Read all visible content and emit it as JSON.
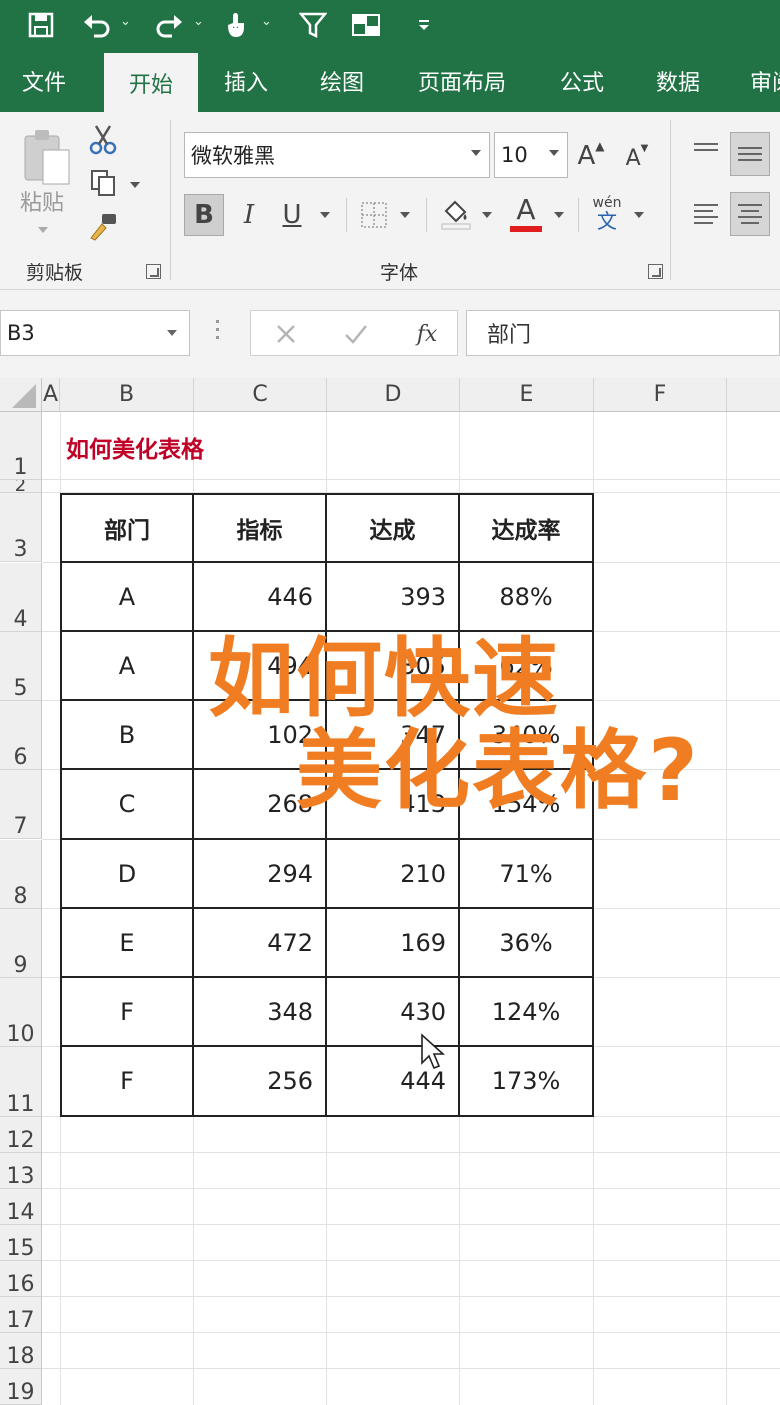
{
  "qat": {
    "icons": [
      "save-icon",
      "undo-icon",
      "redo-icon",
      "touch-mode-icon",
      "filter-icon",
      "freeze-panes-icon",
      "customize-qat-icon"
    ]
  },
  "tabs": [
    {
      "label": "文件"
    },
    {
      "label": "开始",
      "active": true
    },
    {
      "label": "插入"
    },
    {
      "label": "绘图"
    },
    {
      "label": "页面布局"
    },
    {
      "label": "公式"
    },
    {
      "label": "数据"
    },
    {
      "label": "审阅"
    }
  ],
  "ribbon": {
    "clipboard": {
      "paste_label": "粘贴",
      "group_label": "剪贴板"
    },
    "font": {
      "font_name": "微软雅黑",
      "font_size": "10",
      "bold": "B",
      "italic": "I",
      "underline": "U",
      "font_color_glyph": "A",
      "phonetic_top": "wén",
      "phonetic_bottom": "文",
      "grow_glyph": "A",
      "shrink_glyph": "A",
      "group_label": "字体"
    },
    "colors": {
      "font_color": "#e01e1e",
      "accent": "#217346"
    }
  },
  "formula_bar": {
    "name_box": "B3",
    "fx_label": "fx",
    "content": "部门"
  },
  "sheet": {
    "columns": [
      "A",
      "B",
      "C",
      "D",
      "E",
      "F"
    ],
    "rows": [
      "1",
      "2",
      "3",
      "4",
      "5",
      "6",
      "7",
      "8",
      "9",
      "10",
      "11",
      "12",
      "13",
      "14",
      "15",
      "16",
      "17",
      "18",
      "19"
    ],
    "title": "如何美化表格",
    "title_color": "#c00026",
    "table": {
      "headers": [
        "部门",
        "指标",
        "达成",
        "达成率"
      ],
      "rows": [
        [
          "A",
          "446",
          "393",
          "88%"
        ],
        [
          "A",
          "494",
          "305",
          "62%"
        ],
        [
          "B",
          "102",
          "347",
          "340%"
        ],
        [
          "C",
          "268",
          "413",
          "154%"
        ],
        [
          "D",
          "294",
          "210",
          "71%"
        ],
        [
          "E",
          "472",
          "169",
          "36%"
        ],
        [
          "F",
          "348",
          "430",
          "124%"
        ],
        [
          "F",
          "256",
          "444",
          "173%"
        ]
      ]
    }
  },
  "overlay": {
    "line1": "如何快速",
    "line2": "美化表格?",
    "color": "#f07d21"
  }
}
